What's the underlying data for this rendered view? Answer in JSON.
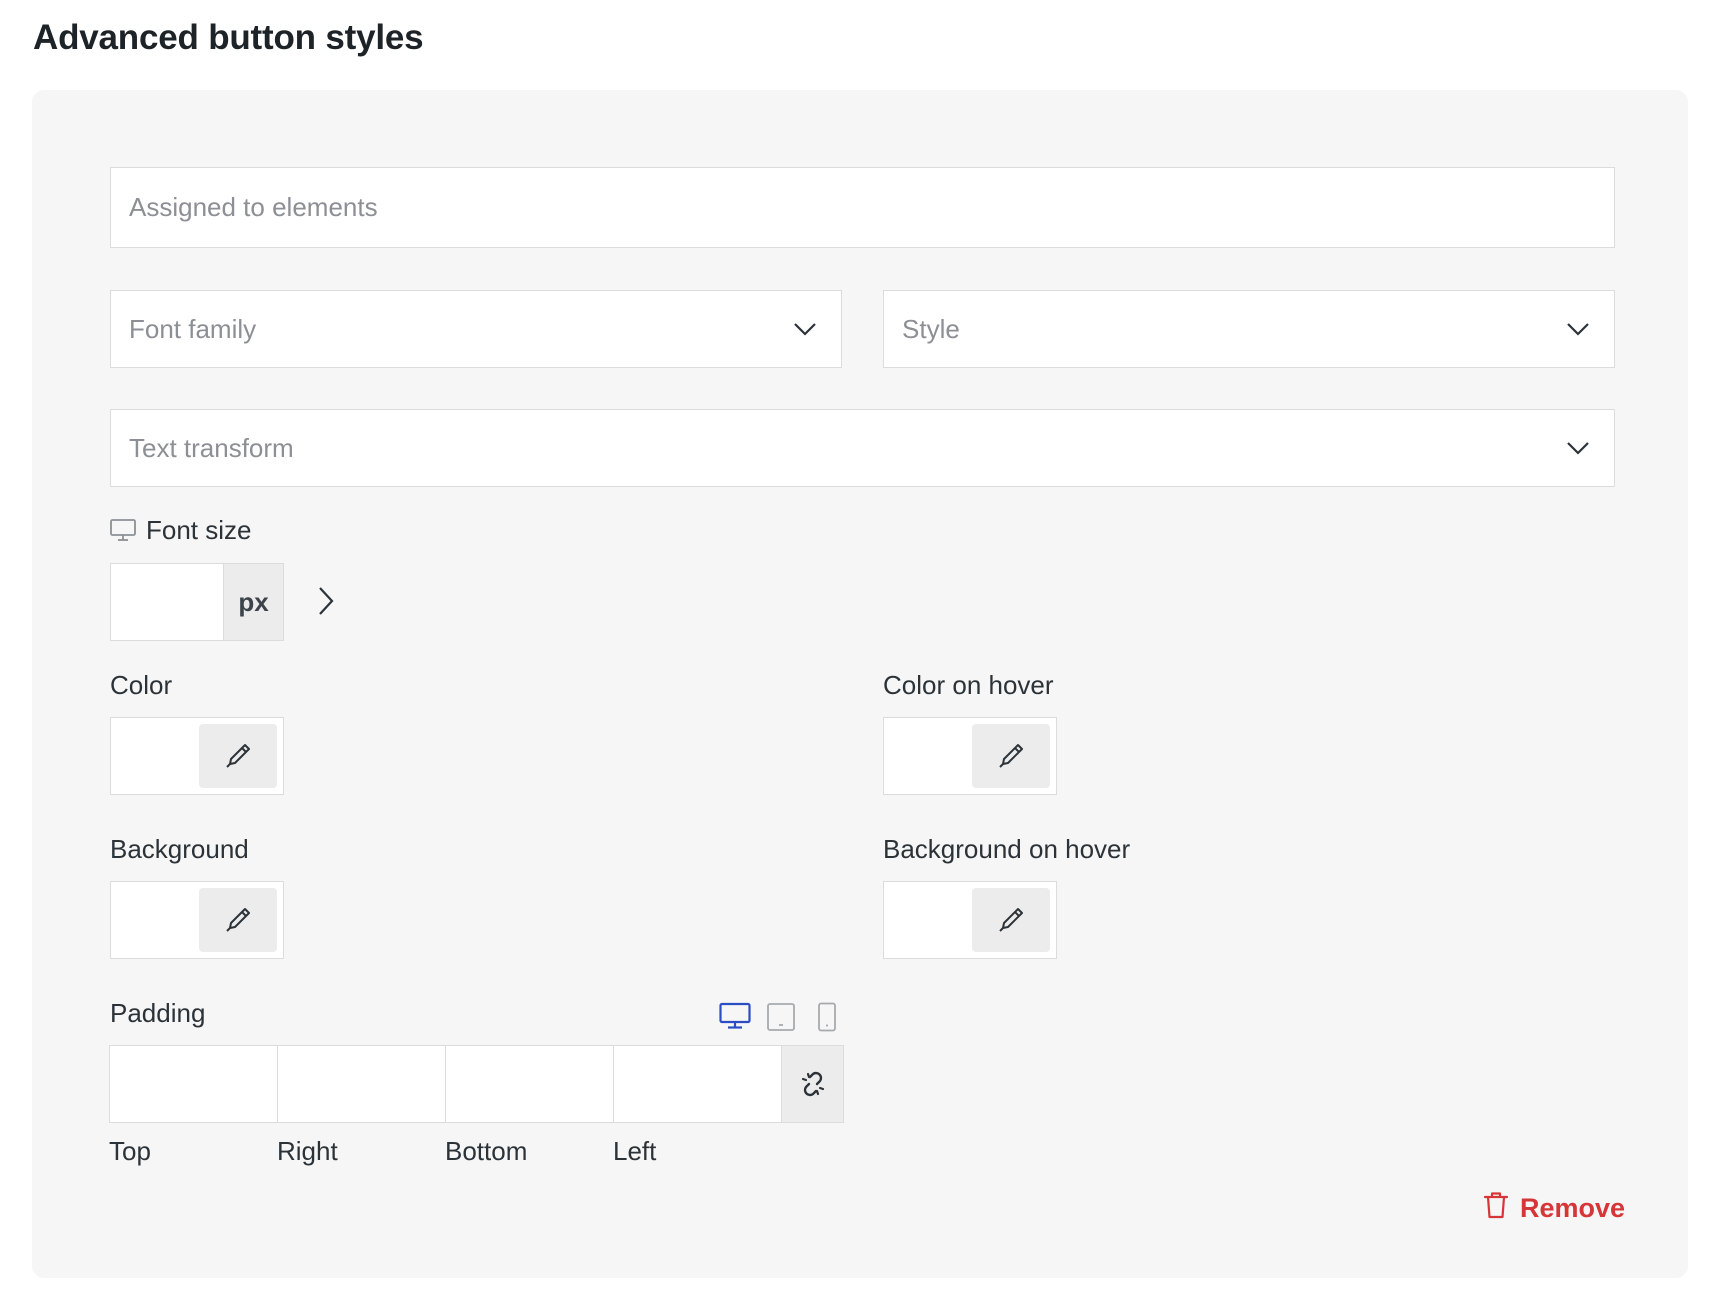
{
  "page": {
    "title": "Advanced button styles"
  },
  "form": {
    "assigned": {
      "placeholder": "Assigned to elements"
    },
    "font_family": {
      "placeholder": "Font family",
      "icon": "chevron-down-icon"
    },
    "style": {
      "placeholder": "Style",
      "icon": "chevron-down-icon"
    },
    "text_transform": {
      "placeholder": "Text transform",
      "icon": "chevron-down-icon"
    },
    "font_size": {
      "label": "Font size",
      "value": "",
      "unit": "px",
      "device_icon": "desktop-icon",
      "expand_icon": "chevron-right-icon"
    },
    "color": {
      "label": "Color",
      "icon": "eyedropper-icon"
    },
    "color_hover": {
      "label": "Color on hover",
      "icon": "eyedropper-icon"
    },
    "background": {
      "label": "Background",
      "icon": "eyedropper-icon"
    },
    "background_hover": {
      "label": "Background on hover",
      "icon": "eyedropper-icon"
    },
    "padding": {
      "label": "Padding",
      "sides": [
        "Top",
        "Right",
        "Bottom",
        "Left"
      ],
      "values": [
        "",
        "",
        "",
        ""
      ],
      "devices": [
        "desktop-icon",
        "tablet-icon",
        "mobile-icon"
      ],
      "active_device": "desktop",
      "link_icon": "unlink-icon"
    },
    "remove": {
      "label": "Remove",
      "icon": "trash-icon"
    }
  },
  "colors": {
    "accent": "#2c4cc4",
    "danger": "#d63638",
    "panel": "#f6f6f6"
  }
}
